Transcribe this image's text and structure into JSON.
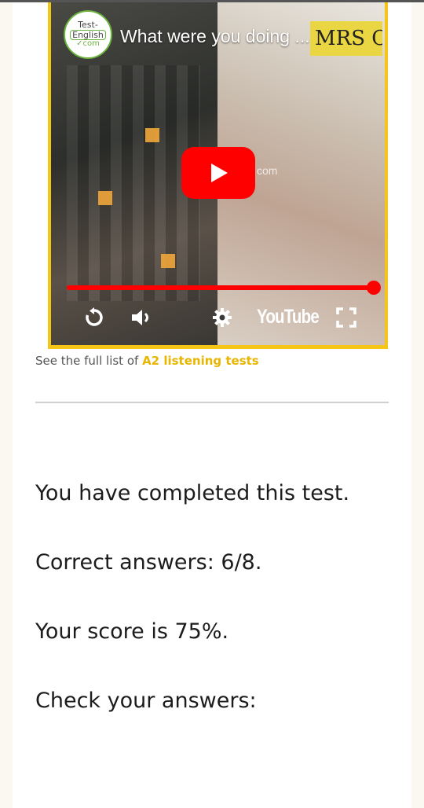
{
  "video": {
    "title": "What were you doing ...",
    "handwritten_overlay": "MRS C",
    "logo": {
      "line1": "Test-",
      "line2": "English",
      "line3": "com"
    },
    "watermark": "com",
    "player_brand": "YouTube",
    "progress": 1.0,
    "icons": [
      "play-icon",
      "replay-icon",
      "volume-icon",
      "settings-icon",
      "fullscreen-icon"
    ],
    "colors": {
      "frame": "#f5c518",
      "play": "#ff0000"
    }
  },
  "links": {
    "prefix": "See the full list of ",
    "tests_link": "A2 listening tests"
  },
  "results": {
    "completed": "You have completed this test.",
    "correct": "Correct answers: 6/8.",
    "score": "Your score is 75%.",
    "check": "Check your answers:"
  }
}
